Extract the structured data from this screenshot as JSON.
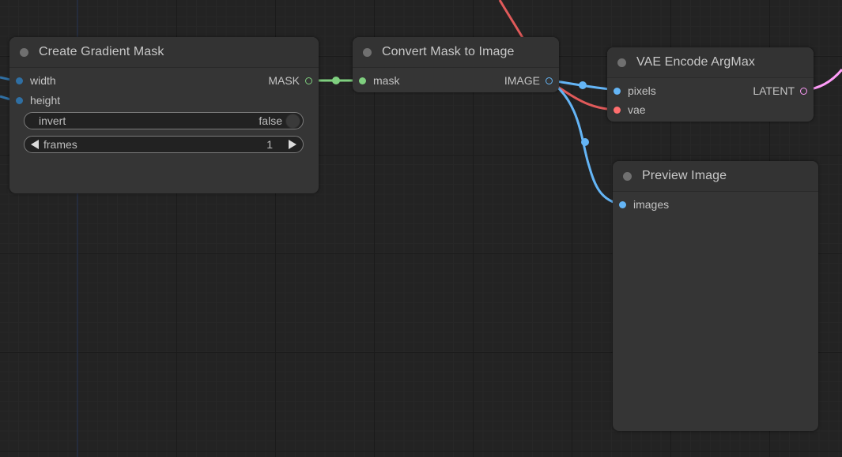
{
  "nodes": {
    "gradient_mask": {
      "title": "Create Gradient Mask",
      "inputs": [
        {
          "label": "width",
          "color": "#2f6fa3"
        },
        {
          "label": "height",
          "color": "#2f6fa3"
        }
      ],
      "output": {
        "label": "MASK",
        "color": "#7fcf7f"
      },
      "widgets": {
        "invert": {
          "label": "invert",
          "value": "false"
        },
        "frames": {
          "label": "frames",
          "value": "1"
        }
      }
    },
    "mask_to_image": {
      "title": "Convert Mask to Image",
      "input": {
        "label": "mask",
        "color": "#7fcf7f"
      },
      "output": {
        "label": "IMAGE",
        "color": "#64b5f6"
      }
    },
    "vae_encode": {
      "title": "VAE Encode ArgMax",
      "inputs": [
        {
          "label": "pixels",
          "color": "#64b5f6"
        },
        {
          "label": "vae",
          "color": "#ff6e6e"
        }
      ],
      "output": {
        "label": "LATENT",
        "color": "#ff9cf9"
      }
    },
    "preview_image": {
      "title": "Preview Image",
      "input": {
        "label": "images",
        "color": "#64b5f6"
      }
    }
  },
  "link_colors": {
    "mask": "#7fcf7f",
    "image": "#64b5f6",
    "vae": "#e05a5a",
    "latent": "#ff9cf9",
    "size": "#2f6fa3"
  }
}
